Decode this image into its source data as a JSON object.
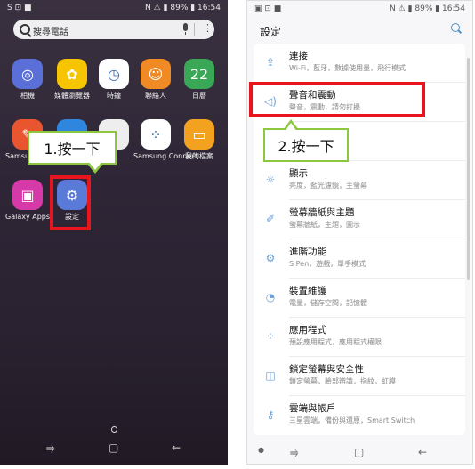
{
  "left": {
    "status_left": "S ⊡ ■",
    "status_right": "N ⚠ ▮ 89% ▮ 16:54",
    "search_text": "搜尋電話",
    "apps": [
      {
        "label": "相機",
        "icon": "camera-icon",
        "glyph": "◎",
        "color": "#5b6fd8"
      },
      {
        "label": "媒體瀏覽器",
        "icon": "gallery-icon",
        "glyph": "✿",
        "color": "#f6c400"
      },
      {
        "label": "時鐘",
        "icon": "clock-icon",
        "glyph": "◷",
        "color": "#ffffff"
      },
      {
        "label": "聯絡人",
        "icon": "contacts-icon",
        "glyph": "☺",
        "color": "#f08a24"
      },
      {
        "label": "日曆",
        "icon": "calendar-icon",
        "glyph": "22",
        "color": "#3aa757"
      },
      {
        "label": "Samsung Notes",
        "icon": "notes-icon",
        "glyph": "✎",
        "color": "#e8552f"
      },
      {
        "label": "",
        "icon": "app-icon",
        "glyph": "",
        "color": "#2e86de"
      },
      {
        "label": "",
        "icon": "app-icon",
        "glyph": "",
        "color": "#eeeeee"
      },
      {
        "label": "Samsung Connect",
        "icon": "connect-icon",
        "glyph": "⁘",
        "color": "#ffffff"
      },
      {
        "label": "我的檔案",
        "icon": "folder-icon",
        "glyph": "▭",
        "color": "#f2a21e"
      },
      {
        "label": "Galaxy Apps",
        "icon": "galaxy-apps-icon",
        "glyph": "▣",
        "color": "#d63aa8"
      },
      {
        "label": "設定",
        "icon": "gear-icon",
        "glyph": "⚙",
        "color": "#5a7ad8"
      }
    ],
    "callout": "1.按一下"
  },
  "right": {
    "status_left": "▣ ⊡ ■",
    "status_right": "N ⚠ ▮ 89% ▮ 16:54",
    "title": "設定",
    "callout": "2.按一下",
    "items": [
      {
        "title": "連接",
        "sub": "Wi-Fi，藍牙，數據使用量，飛行模式",
        "icon": "connection-icon",
        "glyph": "⇪"
      },
      {
        "title": "聲音和震動",
        "sub": "聲音，震動，請勿打擾",
        "icon": "sound-icon",
        "glyph": "◁)"
      },
      {
        "title": "",
        "sub": "",
        "icon": "notification-icon",
        "glyph": "▢"
      },
      {
        "title": "顯示",
        "sub": "亮度，藍光濾鏡，主螢幕",
        "icon": "display-icon",
        "glyph": "☼"
      },
      {
        "title": "螢幕牆紙與主題",
        "sub": "螢幕牆紙，主題，圖示",
        "icon": "theme-icon",
        "glyph": "✐"
      },
      {
        "title": "進階功能",
        "sub": "S Pen，遊戲，單手模式",
        "icon": "advanced-icon",
        "glyph": "⚙"
      },
      {
        "title": "裝置維護",
        "sub": "電量，儲存空間，記憶體",
        "icon": "maintenance-icon",
        "glyph": "◔"
      },
      {
        "title": "應用程式",
        "sub": "預設應用程式，應用程式權限",
        "icon": "apps-icon",
        "glyph": "⁘"
      },
      {
        "title": "鎖定螢幕與安全性",
        "sub": "鎖定螢幕，臉部辨識，指紋，虹膜",
        "icon": "lock-icon",
        "glyph": "◫"
      },
      {
        "title": "雲端與帳戶",
        "sub": "三星雲端，備份與還原，Smart Switch",
        "icon": "key-icon",
        "glyph": "⚷"
      }
    ]
  },
  "nav": {
    "recent": "⥤",
    "home": "▢",
    "back": "←"
  }
}
